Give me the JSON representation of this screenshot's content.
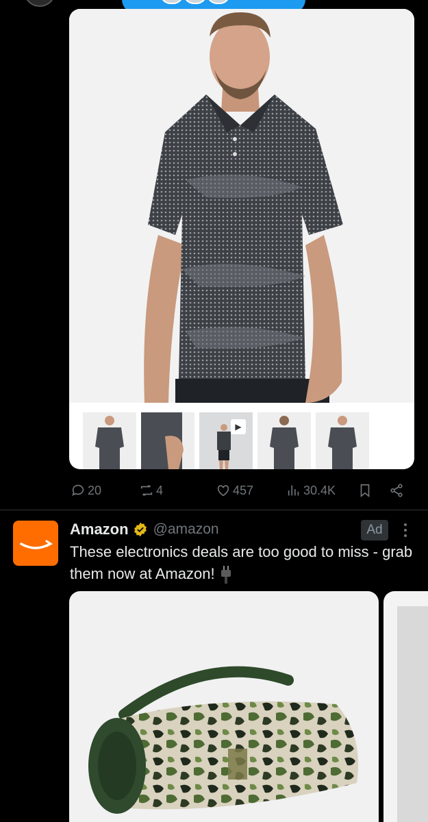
{
  "colors": {
    "background": "#000000",
    "accent": "#1d9bf0",
    "muted_text": "#71767b",
    "amazon_orange": "#ff6d00",
    "verified_gold": "#e2b719"
  },
  "post": {
    "actions": {
      "replies": "20",
      "reposts": "4",
      "likes": "457",
      "views": "30.4K"
    }
  },
  "ad_post": {
    "author_name": "Amazon",
    "handle": "@amazon",
    "ad_label": "Ad",
    "text": "These electronics deals are too good to miss - grab them now at Amazon!"
  }
}
